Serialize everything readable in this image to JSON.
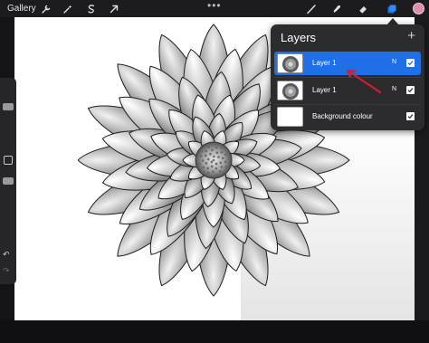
{
  "topbar": {
    "gallery_label": "Gallery",
    "more_label": "•••",
    "left_tools": [
      "wrench-icon",
      "magic-wand-icon",
      "selection-icon",
      "transform-arrow-icon"
    ],
    "right_tools": [
      "brush-icon",
      "smudge-icon",
      "eraser-icon",
      "layers-icon"
    ],
    "current_color": "#d98fae"
  },
  "layers": {
    "title": "Layers",
    "add_label": "+",
    "items": [
      {
        "name": "Layer 1",
        "mode": "N",
        "visible": true,
        "selected": true
      },
      {
        "name": "Layer 1",
        "mode": "N",
        "visible": true,
        "selected": false
      },
      {
        "name": "Background colour",
        "mode": "",
        "visible": true,
        "selected": false
      }
    ]
  },
  "sidebar": {
    "undo_label": "↶",
    "redo_label": "↷"
  },
  "colors": {
    "accent": "#1f6fe8",
    "annotation_arrow": "#d61e2b"
  }
}
